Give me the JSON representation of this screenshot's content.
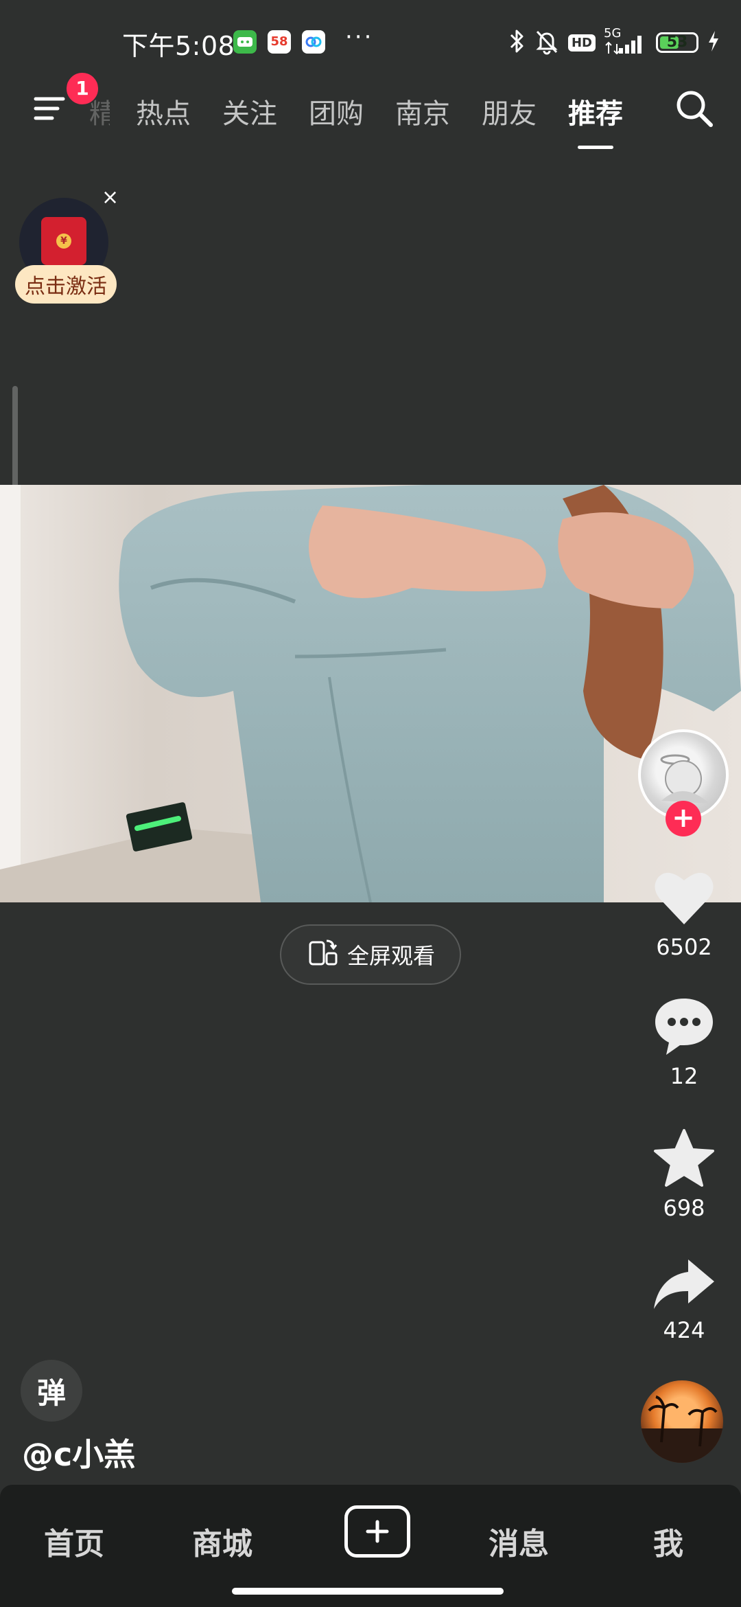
{
  "status_bar": {
    "time": "下午5:08",
    "app_badge": "58",
    "more": "···",
    "network": "5G",
    "hd": "HD",
    "battery_percent": "53",
    "battery_level": 0.53
  },
  "top_nav": {
    "badge_count": "1",
    "partial_tab": "精选",
    "tabs": [
      "热点",
      "关注",
      "团购",
      "南京",
      "朋友",
      "推荐"
    ],
    "active_tab": "推荐"
  },
  "red_packet": {
    "close": "×",
    "coin": "¥",
    "label": "点击激活"
  },
  "video": {
    "fullscreen_label": "全屏观看"
  },
  "rail": {
    "likes": "6502",
    "comments": "12",
    "favorites": "698",
    "shares": "424",
    "follow": "+"
  },
  "caption": {
    "danmu": "弹",
    "username": "@c小羔"
  },
  "bottom_nav": {
    "home": "首页",
    "mall": "商城",
    "messages": "消息",
    "me": "我"
  },
  "colors": {
    "background": "#2e302f",
    "accent": "#fe2c55",
    "nav_bar": "#1c1e1d"
  }
}
